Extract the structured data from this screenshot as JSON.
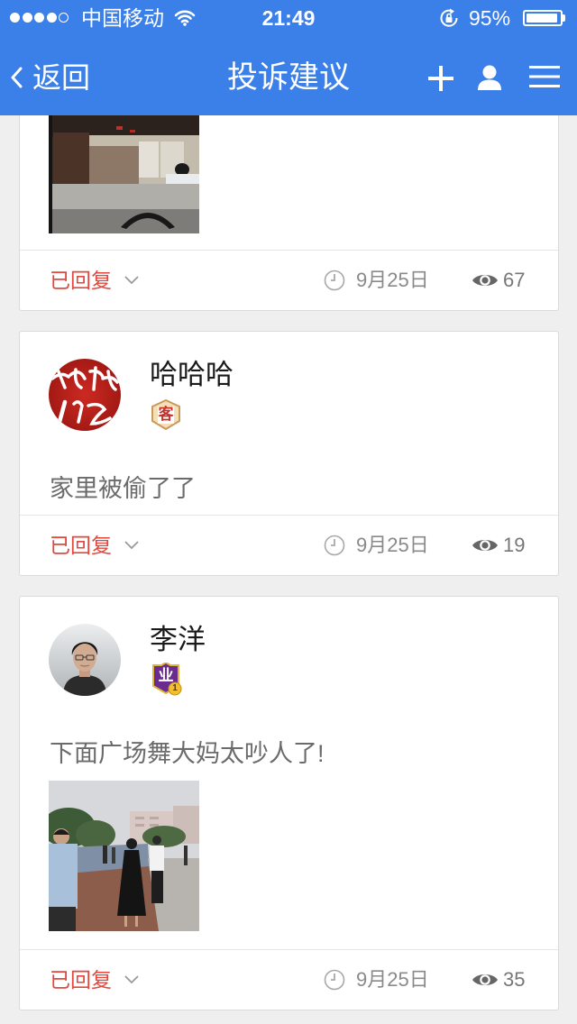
{
  "status_bar": {
    "signal_strength": 4,
    "signal_max": 5,
    "carrier": "中国移动",
    "time": "21:49",
    "battery_text": "95%",
    "battery_level": 0.95
  },
  "nav": {
    "back_label": "返回",
    "title": "投诉建议",
    "icons": [
      "back-chevron-icon",
      "plus-icon",
      "user-icon",
      "menu-icon"
    ]
  },
  "posts": [
    {
      "status": "已回复",
      "date": "9月25日",
      "views": "67"
    },
    {
      "name": "哈哈哈",
      "badge": "客",
      "text": "家里被偷了了",
      "status": "已回复",
      "date": "9月25日",
      "views": "19"
    },
    {
      "name": "李洋",
      "badge": "业",
      "badge_level": "1",
      "text": "下面广场舞大妈太吵人了!",
      "status": "已回复",
      "date": "9月25日",
      "views": "35"
    }
  ],
  "colors": {
    "brand_blue": "#3b7fe9",
    "reply_red": "#e2483d",
    "meta_gray": "#8a8a8a",
    "background": "#efefef"
  }
}
